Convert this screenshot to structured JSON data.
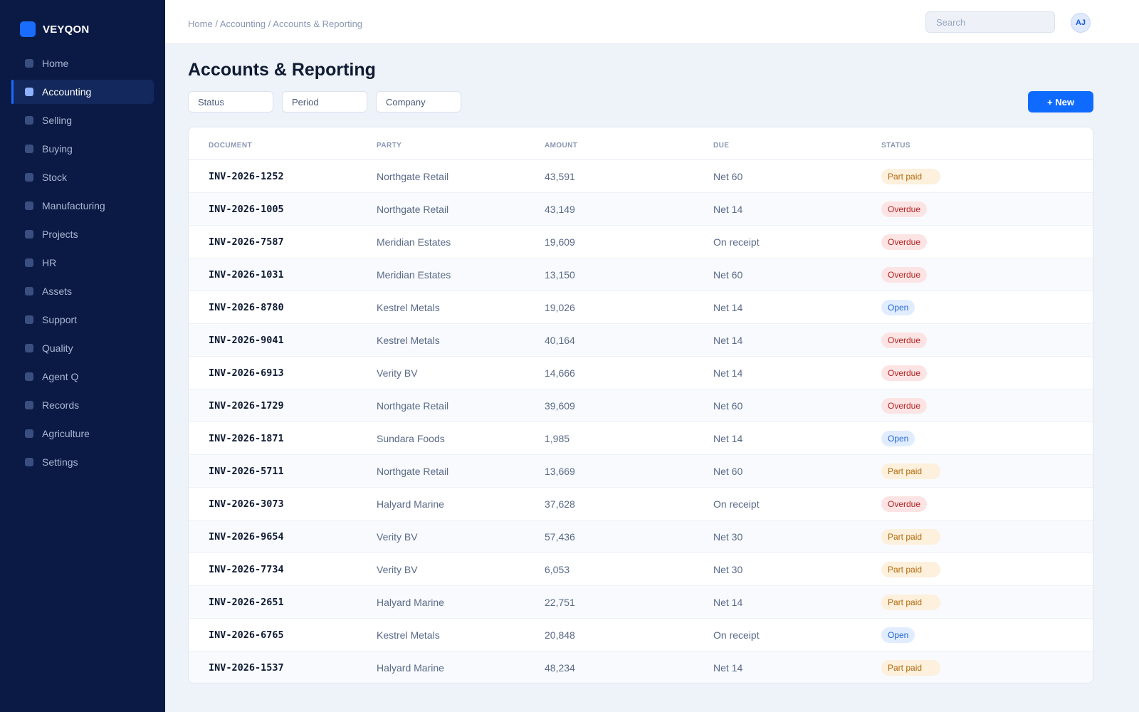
{
  "app": {
    "brand": "VEYQON"
  },
  "sidebar": {
    "items": [
      {
        "label": "Home",
        "active": false
      },
      {
        "label": "Accounting",
        "active": true
      },
      {
        "label": "Selling",
        "active": false
      },
      {
        "label": "Buying",
        "active": false
      },
      {
        "label": "Stock",
        "active": false
      },
      {
        "label": "Manufacturing",
        "active": false
      },
      {
        "label": "Projects",
        "active": false
      },
      {
        "label": "HR",
        "active": false
      },
      {
        "label": "Assets",
        "active": false
      },
      {
        "label": "Support",
        "active": false
      },
      {
        "label": "Quality",
        "active": false
      },
      {
        "label": "Agent Q",
        "active": false
      },
      {
        "label": "Records",
        "active": false
      },
      {
        "label": "Agriculture",
        "active": false
      },
      {
        "label": "Settings",
        "active": false
      }
    ]
  },
  "header": {
    "breadcrumb": [
      "Home",
      "Accounting",
      "Accounts & Reporting"
    ],
    "search_placeholder": "Search",
    "avatar_initials": "AJ"
  },
  "main": {
    "title": "Accounts & Reporting",
    "filters": {
      "status": "Status",
      "period": "Period",
      "company": "Company"
    },
    "new_button": "+ New"
  },
  "table": {
    "columns": [
      "DOCUMENT",
      "PARTY",
      "AMOUNT",
      "DUE",
      "STATUS"
    ],
    "rows": [
      {
        "document": "INV-2026-1252",
        "party": "Northgate Retail",
        "amount": "43,591",
        "due": "Net 60",
        "status": "Part paid"
      },
      {
        "document": "INV-2026-1005",
        "party": "Northgate Retail",
        "amount": "43,149",
        "due": "Net 14",
        "status": "Overdue"
      },
      {
        "document": "INV-2026-7587",
        "party": "Meridian Estates",
        "amount": "19,609",
        "due": "On receipt",
        "status": "Overdue"
      },
      {
        "document": "INV-2026-1031",
        "party": "Meridian Estates",
        "amount": "13,150",
        "due": "Net 60",
        "status": "Overdue"
      },
      {
        "document": "INV-2026-8780",
        "party": "Kestrel Metals",
        "amount": "19,026",
        "due": "Net 14",
        "status": "Open"
      },
      {
        "document": "INV-2026-9041",
        "party": "Kestrel Metals",
        "amount": "40,164",
        "due": "Net 14",
        "status": "Overdue"
      },
      {
        "document": "INV-2026-6913",
        "party": "Verity BV",
        "amount": "14,666",
        "due": "Net 14",
        "status": "Overdue"
      },
      {
        "document": "INV-2026-1729",
        "party": "Northgate Retail",
        "amount": "39,609",
        "due": "Net 60",
        "status": "Overdue"
      },
      {
        "document": "INV-2026-1871",
        "party": "Sundara Foods",
        "amount": "1,985",
        "due": "Net 14",
        "status": "Open"
      },
      {
        "document": "INV-2026-5711",
        "party": "Northgate Retail",
        "amount": "13,669",
        "due": "Net 60",
        "status": "Part paid"
      },
      {
        "document": "INV-2026-3073",
        "party": "Halyard Marine",
        "amount": "37,628",
        "due": "On receipt",
        "status": "Overdue"
      },
      {
        "document": "INV-2026-9654",
        "party": "Verity BV",
        "amount": "57,436",
        "due": "Net 30",
        "status": "Part paid"
      },
      {
        "document": "INV-2026-7734",
        "party": "Verity BV",
        "amount": "6,053",
        "due": "Net 30",
        "status": "Part paid"
      },
      {
        "document": "INV-2026-2651",
        "party": "Halyard Marine",
        "amount": "22,751",
        "due": "Net 14",
        "status": "Part paid"
      },
      {
        "document": "INV-2026-6765",
        "party": "Kestrel Metals",
        "amount": "20,848",
        "due": "On receipt",
        "status": "Open"
      },
      {
        "document": "INV-2026-1537",
        "party": "Halyard Marine",
        "amount": "48,234",
        "due": "Net 14",
        "status": "Part paid"
      }
    ]
  },
  "colors": {
    "sidebar_bg": "#0b1a45",
    "accent": "#0f6bff",
    "overdue": "#b42323",
    "open": "#1f63d8",
    "part_paid": "#b06a0d"
  }
}
